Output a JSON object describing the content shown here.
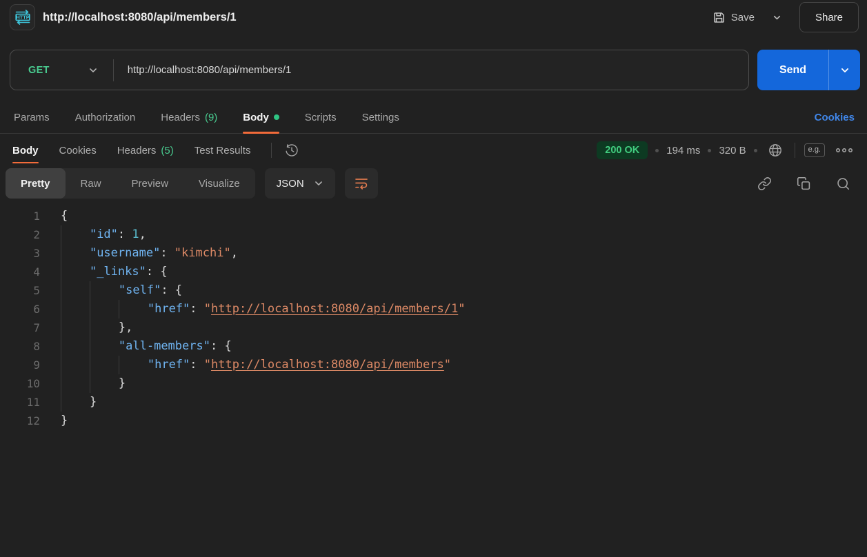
{
  "header": {
    "title": "http://localhost:8080/api/members/1",
    "save_label": "Save",
    "share_label": "Share"
  },
  "request": {
    "method": "GET",
    "url": "http://localhost:8080/api/members/1",
    "send_label": "Send"
  },
  "request_tabs": [
    {
      "label": "Params"
    },
    {
      "label": "Authorization"
    },
    {
      "label": "Headers",
      "count": "(9)"
    },
    {
      "label": "Body",
      "active": true,
      "dot": true
    },
    {
      "label": "Scripts"
    },
    {
      "label": "Settings"
    }
  ],
  "cookies_link": "Cookies",
  "response": {
    "tabs": [
      {
        "label": "Body",
        "active": true
      },
      {
        "label": "Cookies"
      },
      {
        "label": "Headers",
        "count": "(5)"
      },
      {
        "label": "Test Results"
      }
    ],
    "status": "200 OK",
    "time": "194 ms",
    "size": "320 B",
    "example_label": "e.g."
  },
  "viewer": {
    "modes": [
      "Pretty",
      "Raw",
      "Preview",
      "Visualize"
    ],
    "active_mode": "Pretty",
    "language": "JSON"
  },
  "colors": {
    "accent_orange": "#f26b3a",
    "method_green": "#49cc90",
    "send_blue": "#1467db",
    "link_blue": "#4086e8",
    "status_green": "#42ce80",
    "json_key_blue": "#6fb3f0",
    "json_string_orange": "#de8a66",
    "json_number_teal": "#59b8c9"
  },
  "code": {
    "lines": [
      {
        "n": "1",
        "indent": 0,
        "tokens": [
          {
            "c": "pun",
            "t": "{"
          }
        ]
      },
      {
        "n": "2",
        "indent": 1,
        "tokens": [
          {
            "c": "key",
            "t": "\"id\""
          },
          {
            "c": "pun",
            "t": ": "
          },
          {
            "c": "num",
            "t": "1"
          },
          {
            "c": "pun",
            "t": ","
          }
        ]
      },
      {
        "n": "3",
        "indent": 1,
        "tokens": [
          {
            "c": "key",
            "t": "\"username\""
          },
          {
            "c": "pun",
            "t": ": "
          },
          {
            "c": "str",
            "t": "\"kimchi\""
          },
          {
            "c": "pun",
            "t": ","
          }
        ]
      },
      {
        "n": "4",
        "indent": 1,
        "tokens": [
          {
            "c": "key",
            "t": "\"_links\""
          },
          {
            "c": "pun",
            "t": ": {"
          }
        ]
      },
      {
        "n": "5",
        "indent": 2,
        "tokens": [
          {
            "c": "key",
            "t": "\"self\""
          },
          {
            "c": "pun",
            "t": ": {"
          }
        ]
      },
      {
        "n": "6",
        "indent": 3,
        "tokens": [
          {
            "c": "key",
            "t": "\"href\""
          },
          {
            "c": "pun",
            "t": ": "
          },
          {
            "c": "str",
            "t": "\""
          },
          {
            "c": "url",
            "t": "http://localhost:8080/api/members/1"
          },
          {
            "c": "str",
            "t": "\""
          }
        ]
      },
      {
        "n": "7",
        "indent": 2,
        "tokens": [
          {
            "c": "pun",
            "t": "},"
          }
        ]
      },
      {
        "n": "8",
        "indent": 2,
        "tokens": [
          {
            "c": "key",
            "t": "\"all-members\""
          },
          {
            "c": "pun",
            "t": ": {"
          }
        ]
      },
      {
        "n": "9",
        "indent": 3,
        "tokens": [
          {
            "c": "key",
            "t": "\"href\""
          },
          {
            "c": "pun",
            "t": ": "
          },
          {
            "c": "str",
            "t": "\""
          },
          {
            "c": "url",
            "t": "http://localhost:8080/api/members"
          },
          {
            "c": "str",
            "t": "\""
          }
        ]
      },
      {
        "n": "10",
        "indent": 2,
        "tokens": [
          {
            "c": "pun",
            "t": "}"
          }
        ]
      },
      {
        "n": "11",
        "indent": 1,
        "tokens": [
          {
            "c": "pun",
            "t": "}"
          }
        ]
      },
      {
        "n": "12",
        "indent": 0,
        "tokens": [
          {
            "c": "pun",
            "t": "}"
          }
        ]
      }
    ]
  }
}
